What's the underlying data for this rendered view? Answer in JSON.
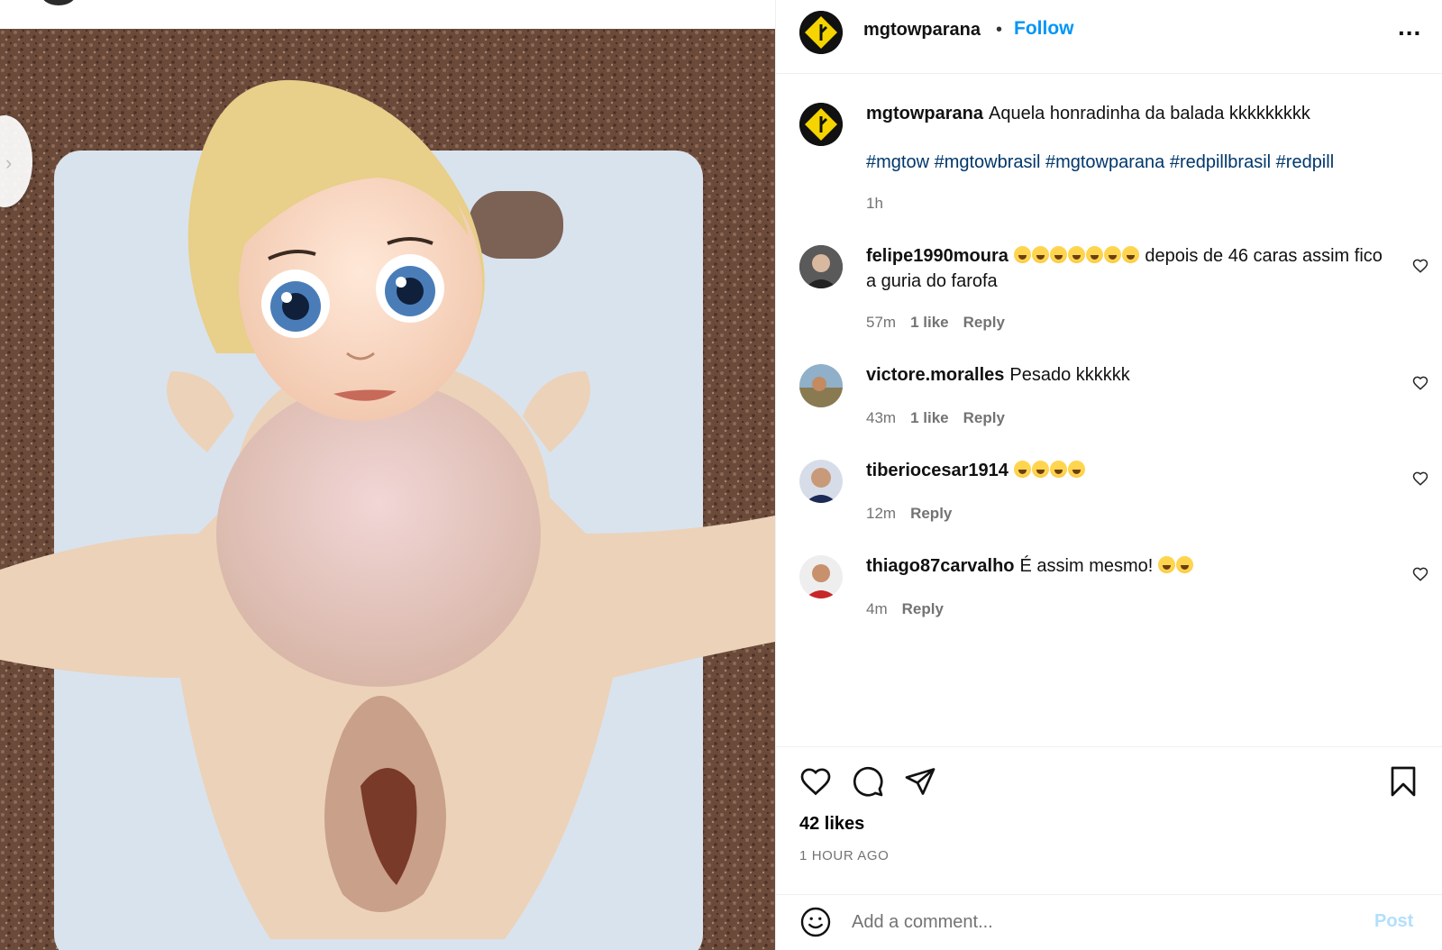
{
  "post": {
    "author": "mgtowparana",
    "follow_label": "Follow",
    "separator": "•",
    "more_label": "..."
  },
  "caption": {
    "username": "mgtowparana",
    "text": "Aquela honradinha da balada kkkkkkkkk",
    "hashtags": "#mgtow #mgtowbrasil #mgtowparana #redpillbrasil #redpill",
    "time": "1h"
  },
  "comments": [
    {
      "username": "felipe1990moura",
      "emoji_count": 7,
      "text": "depois de 46 caras assim fico a guria do farofa",
      "time": "57m",
      "likes": "1 like",
      "reply": "Reply"
    },
    {
      "username": "victore.moralles",
      "emoji_count": 0,
      "text": "Pesado kkkkkk",
      "time": "43m",
      "likes": "1 like",
      "reply": "Reply"
    },
    {
      "username": "tiberiocesar1914",
      "emoji_count": 4,
      "text": "",
      "time": "12m",
      "likes": "",
      "reply": "Reply"
    },
    {
      "username": "thiago87carvalho",
      "emoji_count": 2,
      "text": "É assim mesmo!",
      "time": "4m",
      "likes": "",
      "reply": "Reply"
    }
  ],
  "actions": {
    "likes": "42 likes",
    "time_ago": "1 HOUR AGO"
  },
  "add_comment": {
    "placeholder": "Add a comment...",
    "post_label": "Post"
  },
  "colors": {
    "accent": "#0095f6",
    "hashtag": "#00376b",
    "muted": "#737373",
    "brand_yellow": "#f5d400"
  }
}
